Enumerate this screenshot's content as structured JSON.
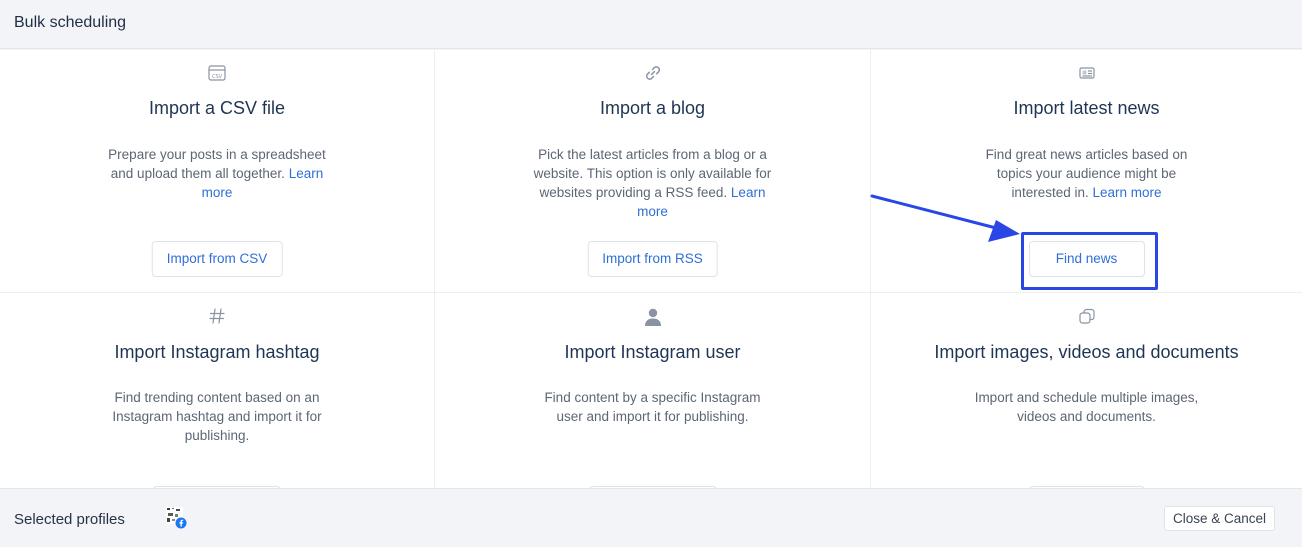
{
  "header": {
    "title": "Bulk scheduling"
  },
  "cards": [
    {
      "icon": "csv-file-icon",
      "title": "Import a CSV file",
      "desc": "Prepare your posts in a spreadsheet and upload them all together.",
      "link": "Learn more",
      "button": "Import from CSV"
    },
    {
      "icon": "link-icon",
      "title": "Import a blog",
      "desc": "Pick the latest articles from a blog or a website. This option is only available for websites providing a RSS feed.",
      "link": "Learn more",
      "button": "Import from RSS"
    },
    {
      "icon": "newspaper-icon",
      "title": "Import latest news",
      "desc": "Find great news articles based on topics your audience might be interested in.",
      "link": "Learn more",
      "button": "Find news"
    },
    {
      "icon": "hashtag-icon",
      "title": "Import Instagram hashtag",
      "desc": "Find trending content based on an Instagram hashtag and import it for publishing."
    },
    {
      "icon": "user-icon",
      "title": "Import Instagram user",
      "desc": "Find content by a specific Instagram user and import it for publishing."
    },
    {
      "icon": "copy-icon",
      "title": "Import images, videos and documents",
      "desc": "Import and schedule multiple images, videos and documents."
    }
  ],
  "footer": {
    "selected_profiles_label": "Selected profiles",
    "profile_icon": "facebook-profile-avatar",
    "close_label": "Close & Cancel"
  },
  "colors": {
    "accent": "#2f6fd6",
    "annotation": "#2a47e6"
  }
}
